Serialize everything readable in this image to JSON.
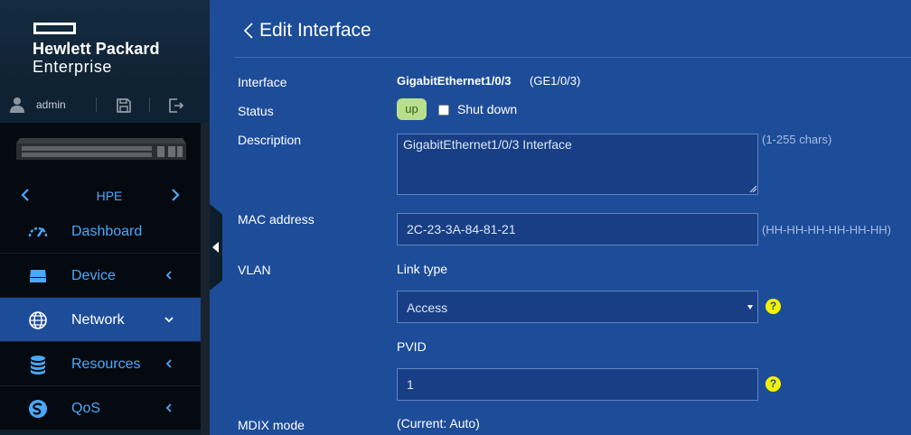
{
  "brand": {
    "line1": "Hewlett Packard",
    "line2": "Enterprise"
  },
  "user": {
    "name": "admin"
  },
  "device_selector": {
    "name": "HPE"
  },
  "nav": {
    "items": [
      {
        "label": "Dashboard",
        "icon": "gauge-icon",
        "active": false,
        "arrow": "none"
      },
      {
        "label": "Device",
        "icon": "device-icon",
        "active": false,
        "arrow": "left"
      },
      {
        "label": "Network",
        "icon": "globe-icon",
        "active": true,
        "arrow": "down"
      },
      {
        "label": "Resources",
        "icon": "database-icon",
        "active": false,
        "arrow": "left"
      },
      {
        "label": "QoS",
        "icon": "qos-icon",
        "active": false,
        "arrow": "left"
      }
    ]
  },
  "page": {
    "title": "Edit Interface"
  },
  "form": {
    "interface": {
      "label": "Interface",
      "name": "GigabitEthernet1/0/3",
      "short": "(GE1/0/3)"
    },
    "status": {
      "label": "Status",
      "badge": "up",
      "shutdown_label": "Shut down",
      "shutdown_checked": false
    },
    "description": {
      "label": "Description",
      "value": "GigabitEthernet1/0/3 Interface",
      "hint": "(1-255 chars)"
    },
    "mac": {
      "label": "MAC address",
      "value": "2C-23-3A-84-81-21",
      "hint": "(HH-HH-HH-HH-HH-HH)"
    },
    "vlan": {
      "label": "VLAN",
      "link_type_label": "Link type",
      "link_type_value": "Access",
      "pvid_label": "PVID",
      "pvid_value": "1"
    },
    "mdix": {
      "label": "MDIX mode",
      "current": "(Current: Auto)"
    }
  },
  "help_text": "?",
  "colors": {
    "accent": "#4aa8ff",
    "page_bg": "#1d4d99",
    "sidebar_bg": "#050a10",
    "status_up": "#b8e08c",
    "help": "#f4f200"
  }
}
